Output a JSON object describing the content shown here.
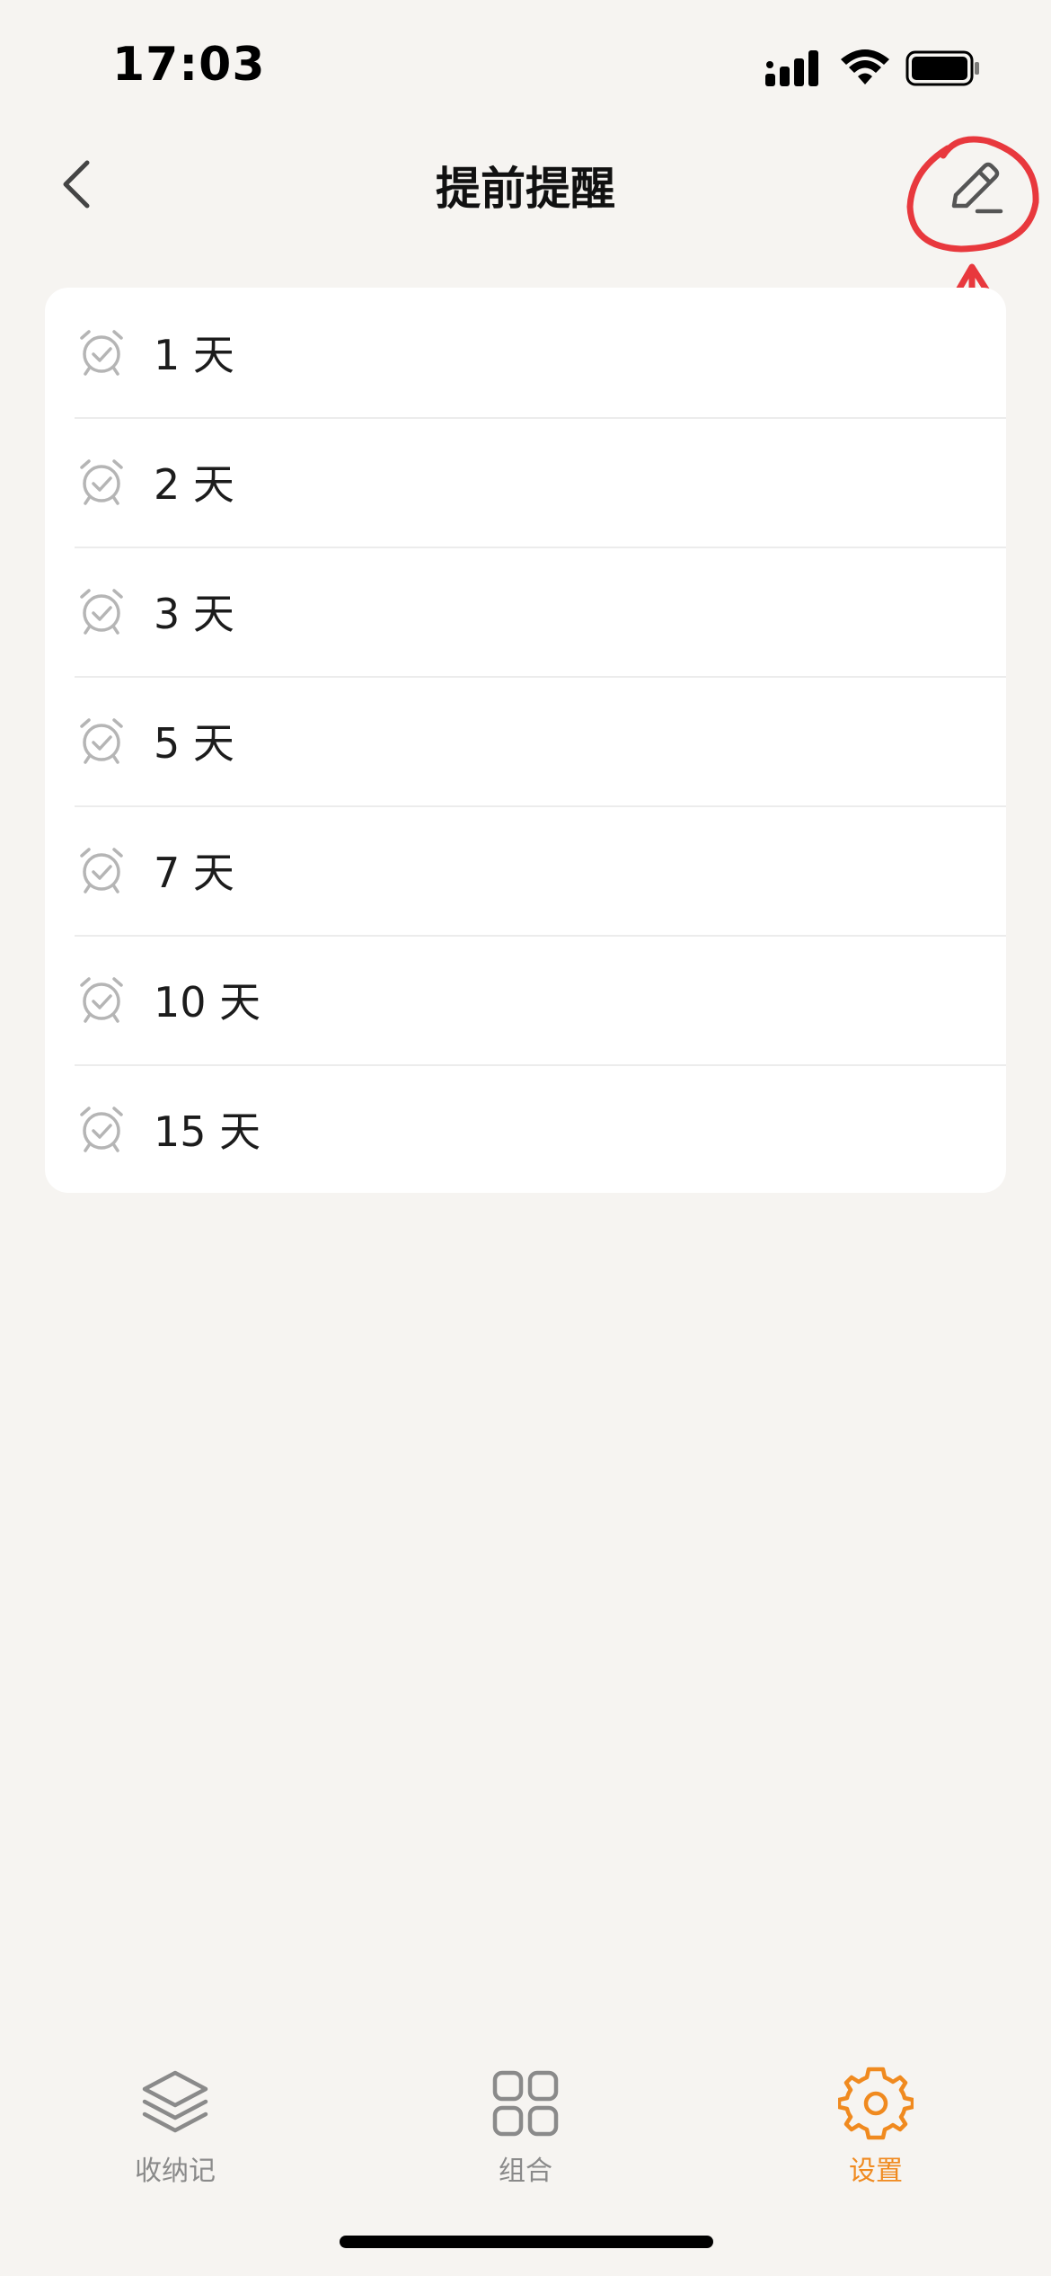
{
  "status_bar": {
    "time": "17:03"
  },
  "nav": {
    "title": "提前提醒"
  },
  "reminders": [
    {
      "label": "1 天"
    },
    {
      "label": "2 天"
    },
    {
      "label": "3 天"
    },
    {
      "label": "5 天"
    },
    {
      "label": "7 天"
    },
    {
      "label": "10 天"
    },
    {
      "label": "15 天"
    }
  ],
  "tabs": [
    {
      "label": "收纳记",
      "icon": "layers-icon",
      "active": false
    },
    {
      "label": "组合",
      "icon": "grid-icon",
      "active": false
    },
    {
      "label": "设置",
      "icon": "gear-icon",
      "active": true
    }
  ],
  "colors": {
    "background": "#f6f4f1",
    "accent": "#f08a1f",
    "annotation": "#e8383d",
    "icon_gray": "#b5b5b5"
  }
}
